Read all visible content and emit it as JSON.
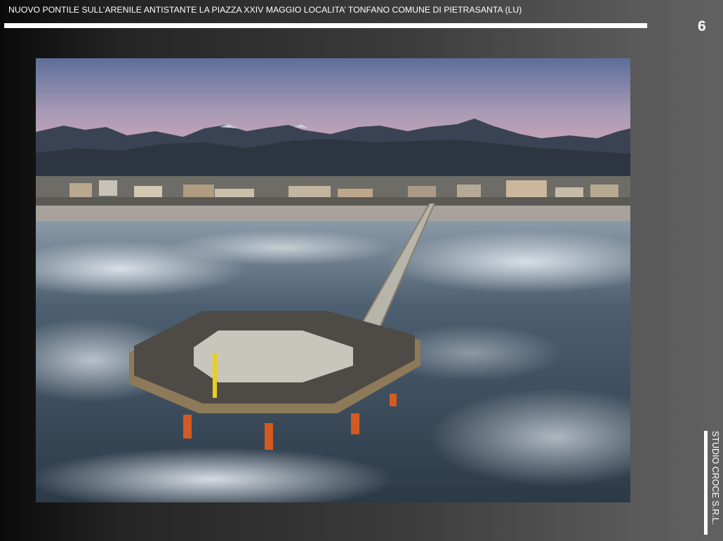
{
  "slide": {
    "title": "NUOVO PONTILE SULL’ARENILE ANTISTANTE LA PIAZZA XXIV MAGGIO  LOCALITA’  TONFANO COMUNE DI PIETRASANTA (LU)",
    "page_number": "6",
    "company": "STUDIO CROCE S.R.L."
  },
  "photo": {
    "subject": "aerial-pier-photo"
  },
  "colors": {
    "background_dark": "#0a0a0a",
    "background_light": "#616161",
    "text": "#ffffff"
  }
}
